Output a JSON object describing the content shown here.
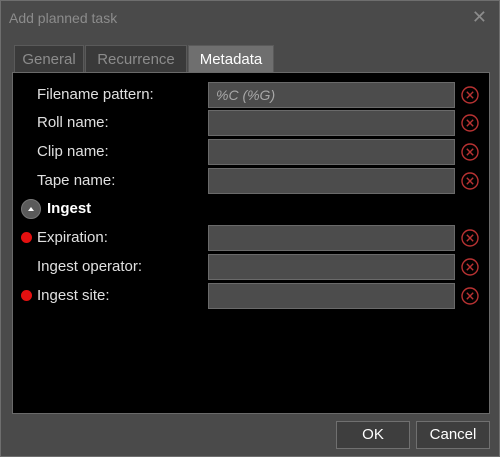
{
  "window": {
    "title": "Add planned task",
    "close_glyph": "✕"
  },
  "tabs": [
    {
      "label": "General",
      "active": false
    },
    {
      "label": "Recurrence",
      "active": false
    },
    {
      "label": "Metadata",
      "active": true
    }
  ],
  "fields": {
    "filename_pattern": {
      "label": "Filename pattern:",
      "value": "%C (%G)",
      "required": false
    },
    "roll_name": {
      "label": "Roll name:",
      "value": "",
      "required": false
    },
    "clip_name": {
      "label": "Clip name:",
      "value": "",
      "required": false
    },
    "tape_name": {
      "label": "Tape name:",
      "value": "",
      "required": false
    }
  },
  "ingest_section": {
    "title": "Ingest",
    "expanded": true,
    "fields": {
      "expiration": {
        "label": "Expiration:",
        "value": "",
        "required": true
      },
      "ingest_operator": {
        "label": "Ingest operator:",
        "value": "",
        "required": false
      },
      "ingest_site": {
        "label": "Ingest site:",
        "value": "",
        "required": true
      }
    }
  },
  "footer": {
    "ok_label": "OK",
    "cancel_label": "Cancel"
  },
  "colors": {
    "required_marker": "#e41010",
    "clear_icon": "#b83232",
    "panel_background": "#000000",
    "dialog_background": "#4a4a4a"
  },
  "icons": {
    "clear": "clear-field-icon",
    "collapse": "collapse-section-icon",
    "close": "close-icon"
  }
}
